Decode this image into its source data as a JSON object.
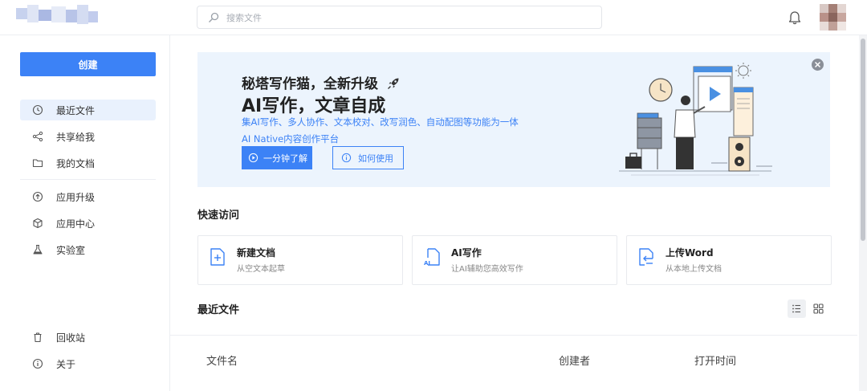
{
  "header": {
    "search_placeholder": "搜索文件"
  },
  "sidebar": {
    "create_label": "创建",
    "items": [
      {
        "label": "最近文件",
        "icon": "clock-icon",
        "active": true
      },
      {
        "label": "共享给我",
        "icon": "share-icon"
      },
      {
        "label": "我的文档",
        "icon": "folder-icon"
      },
      {
        "label": "应用升级",
        "icon": "upgrade-icon"
      },
      {
        "label": "应用中心",
        "icon": "cube-icon"
      },
      {
        "label": "实验室",
        "icon": "flask-icon"
      },
      {
        "label": "回收站",
        "icon": "trash-icon"
      },
      {
        "label": "关于",
        "icon": "info-icon"
      }
    ]
  },
  "banner": {
    "title_line1": "秘塔写作猫，全新升级",
    "title_line2": "AI写作，文章自成",
    "desc_line1": "集AI写作、多人协作、文本校对、改写润色、自动配图等功能为一体",
    "desc_line2": "AI Native内容创作平台",
    "button_primary": "一分钟了解",
    "button_secondary": "如何使用",
    "colors": {
      "background": "#ecf4fd",
      "accent": "#3c82f6"
    }
  },
  "quick_access": {
    "title": "快速访问",
    "cards": [
      {
        "title": "新建文档",
        "subtitle": "从空文本起草",
        "icon": "new-doc-icon"
      },
      {
        "title": "AI写作",
        "subtitle": "让AI辅助您高效写作",
        "icon": "ai-doc-icon"
      },
      {
        "title": "上传Word",
        "subtitle": "从本地上传文档",
        "icon": "upload-doc-icon"
      }
    ]
  },
  "recent_files": {
    "title": "最近文件",
    "view_modes": [
      "list-view-icon",
      "grid-view-icon"
    ],
    "columns": [
      "文件名",
      "创建者",
      "打开时间"
    ]
  }
}
